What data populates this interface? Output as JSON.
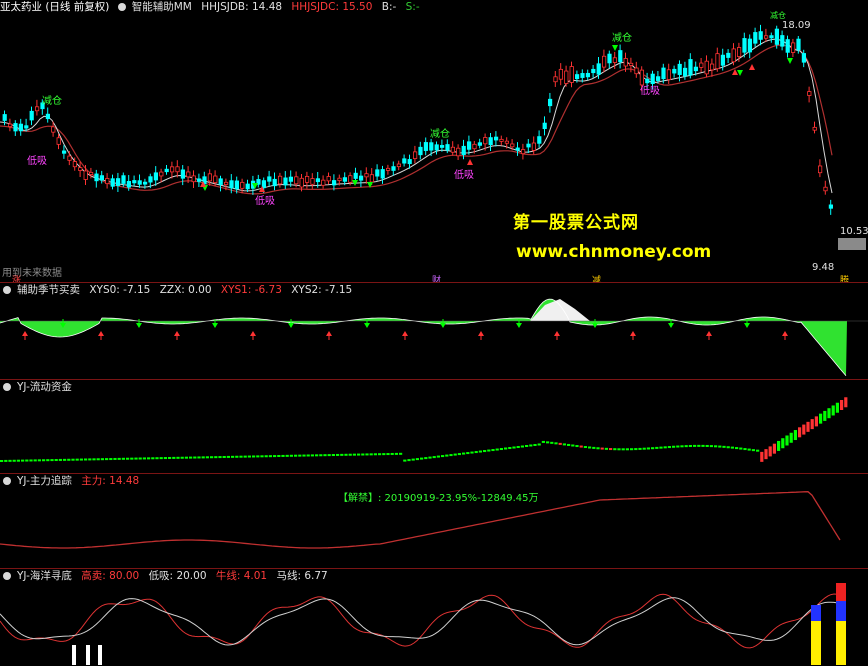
{
  "main": {
    "stock_name": "亚太药业 (日线 前复权)",
    "indicator_name": "智能辅助MM",
    "items": [
      {
        "text": "HHJSJDB: 14.48",
        "color": "#e0e0e0"
      },
      {
        "text": "HHJSJDC: 15.50",
        "color": "#ff3b3b"
      },
      {
        "text": "B:-",
        "color": "#e0e0e0"
      },
      {
        "text": "S:-",
        "color": "#33cc33"
      }
    ],
    "price_labels": {
      "high": "18.09",
      "mid": "10.53",
      "low": "9.48"
    },
    "signal_labels": [
      "减仓",
      "减仓",
      "减仓",
      "减仓"
    ],
    "buy_labels": [
      "低吸",
      "低吸",
      "低吸",
      "低吸"
    ],
    "left_note": "用到未来数据",
    "bottom_marks": [
      "涨",
      "财",
      "减",
      "腾"
    ],
    "watermark": {
      "line1": "第一股票公式网",
      "line2": "www.chnmoney.com"
    }
  },
  "panel1": {
    "title": "辅助季节买卖",
    "items": [
      {
        "text": "XYS0: -7.15",
        "color": "#e0e0e0"
      },
      {
        "text": "ZZX: 0.00",
        "color": "#e0e0e0"
      },
      {
        "text": "XYS1: -6.73",
        "color": "#ff3b3b"
      },
      {
        "text": "XYS2: -7.15",
        "color": "#e0e0e0"
      }
    ]
  },
  "panel2": {
    "title": "YJ-流动资金"
  },
  "panel3": {
    "title": "YJ-主力追踪",
    "items": [
      {
        "text": "主力: 14.48",
        "color": "#ff3b3b"
      }
    ],
    "note": "【解禁】: 20190919-23.95%-12849.45万"
  },
  "panel4": {
    "title": "YJ-海洋寻底",
    "items": [
      {
        "text": "高卖: 80.00",
        "color": "#ff3b3b"
      },
      {
        "text": "低吸: 20.00",
        "color": "#e0e0e0"
      },
      {
        "text": "牛线: 4.01",
        "color": "#ff3b3b"
      },
      {
        "text": "马线: 6.77",
        "color": "#e0e0e0"
      }
    ]
  },
  "colors": {
    "up": "#ff3333",
    "down": "#00ffff",
    "ma": "#ffff00",
    "ma2": "#b03030",
    "green": "#00ff00",
    "magenta": "#ff44ff"
  }
}
